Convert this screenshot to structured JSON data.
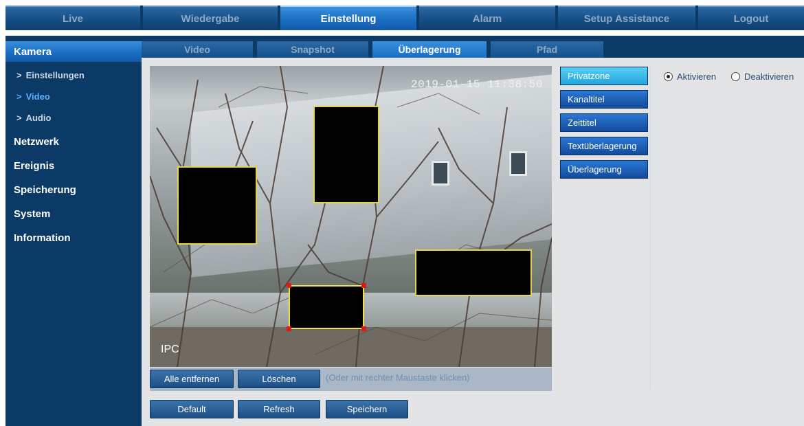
{
  "topnav": {
    "tabs": [
      {
        "label": "Live"
      },
      {
        "label": "Wiedergabe"
      },
      {
        "label": "Einstellung"
      },
      {
        "label": "Alarm"
      },
      {
        "label": "Setup Assistance"
      },
      {
        "label": "Logout"
      }
    ]
  },
  "sidebar": {
    "kamera": "Kamera",
    "einstellungen": "Einstellungen",
    "video": "Video",
    "audio": "Audio",
    "netzwerk": "Netzwerk",
    "ereignis": "Ereignis",
    "speicherung": "Speicherung",
    "system": "System",
    "information": "Information",
    "chevron": ">"
  },
  "subtabs": [
    "Video",
    "Snapshot",
    "Überlagerung",
    "Pfad"
  ],
  "video": {
    "timestamp": "2019-01-15 11:38:50",
    "channel_label": "IPC"
  },
  "zone_actions": {
    "remove_all": "Alle entfernen",
    "delete": "Löschen",
    "hint": "(Oder mit rechter Maustaste klicken)"
  },
  "overlay_types": [
    "Privatzone",
    "Kanaltitel",
    "Zeittitel",
    "Textüberlagerung",
    "Überlagerung"
  ],
  "mode": {
    "enable": "Aktivieren",
    "disable": "Deaktivieren",
    "selected": "Aktivieren"
  },
  "footer": {
    "default": "Default",
    "refresh": "Refresh",
    "save": "Speichern"
  }
}
